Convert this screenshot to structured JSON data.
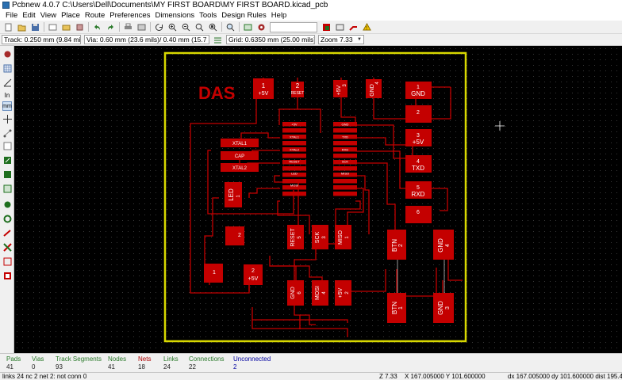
{
  "window": {
    "title": "Pcbnew 4.0.7 C:\\Users\\Dell\\Documents\\MY FIRST BOARD\\MY FIRST BOARD.kicad_pcb"
  },
  "menu": [
    "File",
    "Edit",
    "View",
    "Place",
    "Route",
    "Preferences",
    "Dimensions",
    "Tools",
    "Design Rules",
    "Help"
  ],
  "toolbar2": {
    "track": "Track: 0.250 mm (9.84 mils) *",
    "via": "Via: 0.60 mm (23.6 mils)/ 0.40 mm (15.7 mils) *",
    "grid": "Grid: 0.6350 mm (25.00 mils)",
    "zoom": "Zoom 7.33"
  },
  "board": {
    "title_text": "DAS",
    "header_pins": [
      {
        "num": "1",
        "label": "+5V"
      },
      {
        "num": "2",
        "label": "RESET"
      },
      {
        "num": "3",
        "label": "+5V"
      },
      {
        "num": "4",
        "label": "GND"
      }
    ],
    "right_connector": [
      {
        "num": "1",
        "label": "GND"
      },
      {
        "num": "2",
        "label": ""
      },
      {
        "num": "3",
        "label": "+5V"
      },
      {
        "num": "4",
        "label": "TXD"
      },
      {
        "num": "5",
        "label": "RXD"
      },
      {
        "num": "6",
        "label": ""
      }
    ],
    "ic_left_labels": [
      "+5V",
      "XTAL1",
      "XTAL2",
      "RESET",
      "LED",
      "MOSI"
    ],
    "ic_right_labels": [
      "GND",
      "TXD",
      "RXD",
      "SCK",
      "MISO",
      ""
    ],
    "parts": {
      "xtal1": "XTAL1",
      "cap": "CAP",
      "xtal2": "XTAL2",
      "led": "LED",
      "led_num": "1",
      "pin2": "2",
      "pin1": "1",
      "pin_5v": "+5V",
      "pin_5v_num": "2",
      "reset": "RESET",
      "reset_num": "5",
      "sck": "SCK",
      "sck_num": "3",
      "miso": "MISO",
      "miso_num": "1",
      "btn_a": "BTN",
      "btn_a_num": "2",
      "gnd_a": "GND",
      "gnd_a_num": "4",
      "gnd_b": "GND",
      "gnd_b_num": "6",
      "mosi_b": "MOSI",
      "mosi_b_num": "4",
      "v5_b": "+5V",
      "v5_b_num": "2",
      "btn_b": "BTN",
      "btn_b_num": "1",
      "gnd_c": "GND",
      "gnd_c_num": "3"
    }
  },
  "msgpanel": [
    {
      "h": "Pads",
      "v": "41"
    },
    {
      "h": "Vias",
      "v": "0"
    },
    {
      "h": "Track Segments",
      "v": "93"
    },
    {
      "h": "Nodes",
      "v": "41"
    },
    {
      "h": "Nets",
      "v": "18"
    },
    {
      "h": "Links",
      "v": "24"
    },
    {
      "h": "Connections",
      "v": "22"
    },
    {
      "h": "Unconnected",
      "v": "2"
    }
  ],
  "status": {
    "left": "links 24 nc 2  net 2: not conn 0",
    "z": "Z 7.33",
    "xy": "X 167.005000  Y 101.600000",
    "dxy": "dx 167.005000  dy 101.600000  dist 195.482"
  },
  "colors": {
    "copper": "#c40000",
    "silk": "#ffffff",
    "edge": "#d8d800",
    "background": "#000000"
  }
}
